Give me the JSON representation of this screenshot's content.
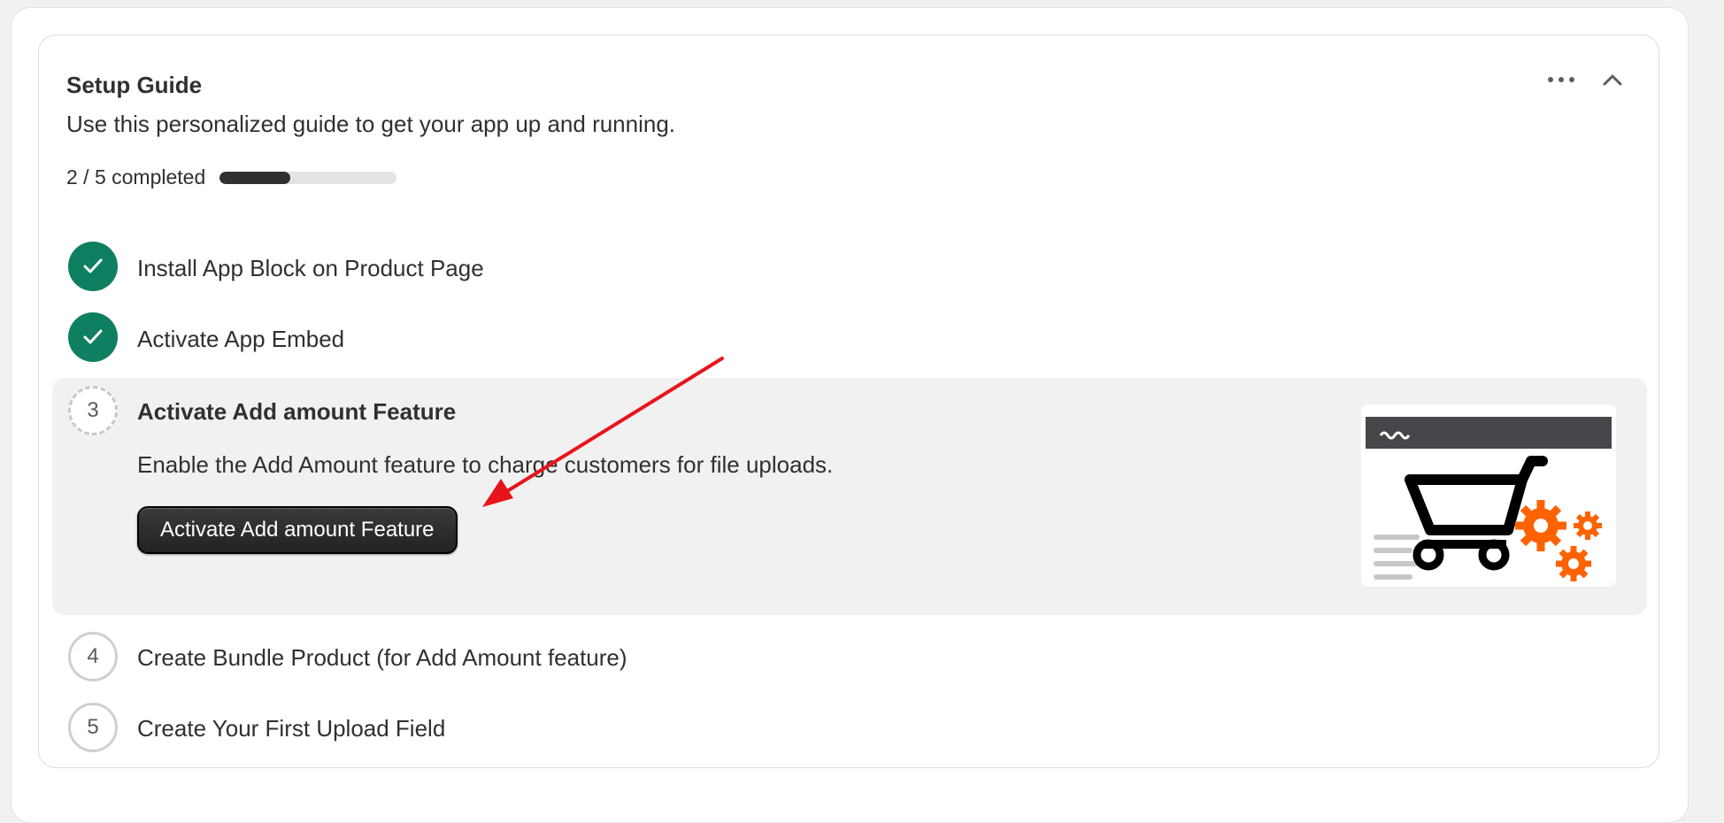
{
  "guide": {
    "title": "Setup Guide",
    "subtitle": "Use this personalized guide to get your app up and running.",
    "progress_label": "2 / 5 completed",
    "progress_completed": 2,
    "progress_total": 5,
    "icons": {
      "more": "more-horizontal-icon",
      "collapse": "chevron-up-icon"
    }
  },
  "steps": [
    {
      "number": "1",
      "title": "Install App Block on Product Page",
      "status": "completed"
    },
    {
      "number": "2",
      "title": "Activate App Embed",
      "status": "completed"
    },
    {
      "number": "3",
      "title": "Activate Add amount Feature",
      "status": "active",
      "description": "Enable the Add Amount feature to charge customers for file uploads.",
      "button_label": "Activate Add amount Feature"
    },
    {
      "number": "4",
      "title": "Create Bundle Product (for Add Amount feature)",
      "status": "todo"
    },
    {
      "number": "5",
      "title": "Create Your First Upload Field",
      "status": "todo"
    }
  ],
  "colors": {
    "completed": "#0e7f61",
    "progress_fill": "#303030",
    "annotation_arrow": "#e8141b",
    "gears": "#ff6200"
  }
}
